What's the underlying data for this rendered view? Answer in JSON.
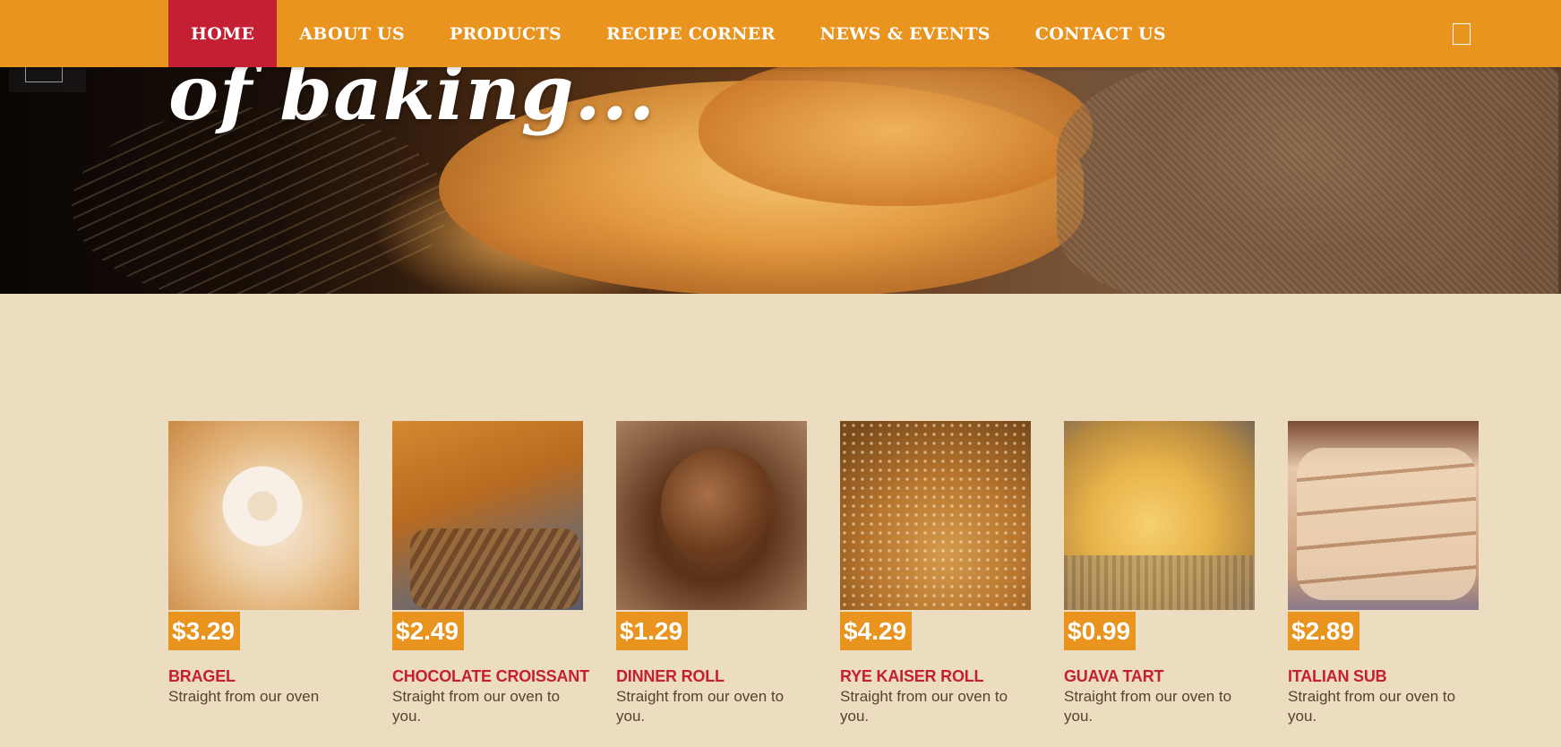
{
  "nav": {
    "items": [
      {
        "label": "HOME",
        "active": true
      },
      {
        "label": "ABOUT US",
        "active": false
      },
      {
        "label": "PRODUCTS",
        "active": false
      },
      {
        "label": "RECIPE CORNER",
        "active": false
      },
      {
        "label": "NEWS & EVENTS",
        "active": false
      },
      {
        "label": "CONTACT US",
        "active": false
      }
    ],
    "search_icon": "search-icon"
  },
  "hero": {
    "heading": "of baking..."
  },
  "products": [
    {
      "price": "$3.29",
      "name": "BRAGEL",
      "description": "Straight from our oven"
    },
    {
      "price": "$2.49",
      "name": "CHOCOLATE CROISSANT",
      "description": "Straight from our oven to you."
    },
    {
      "price": "$1.29",
      "name": "DINNER ROLL",
      "description": "Straight from our oven to you."
    },
    {
      "price": "$4.29",
      "name": "RYE KAISER ROLL",
      "description": "Straight from our oven to you."
    },
    {
      "price": "$0.99",
      "name": "GUAVA TART",
      "description": "Straight from our oven to you."
    },
    {
      "price": "$2.89",
      "name": "ITALIAN SUB",
      "description": "Straight from our oven to you."
    }
  ],
  "colors": {
    "nav_bg": "#e8941e",
    "nav_active": "#c41f33",
    "page_bg": "#ecdcc0",
    "product_name": "#c41f33",
    "price_badge": "#e8941e"
  }
}
